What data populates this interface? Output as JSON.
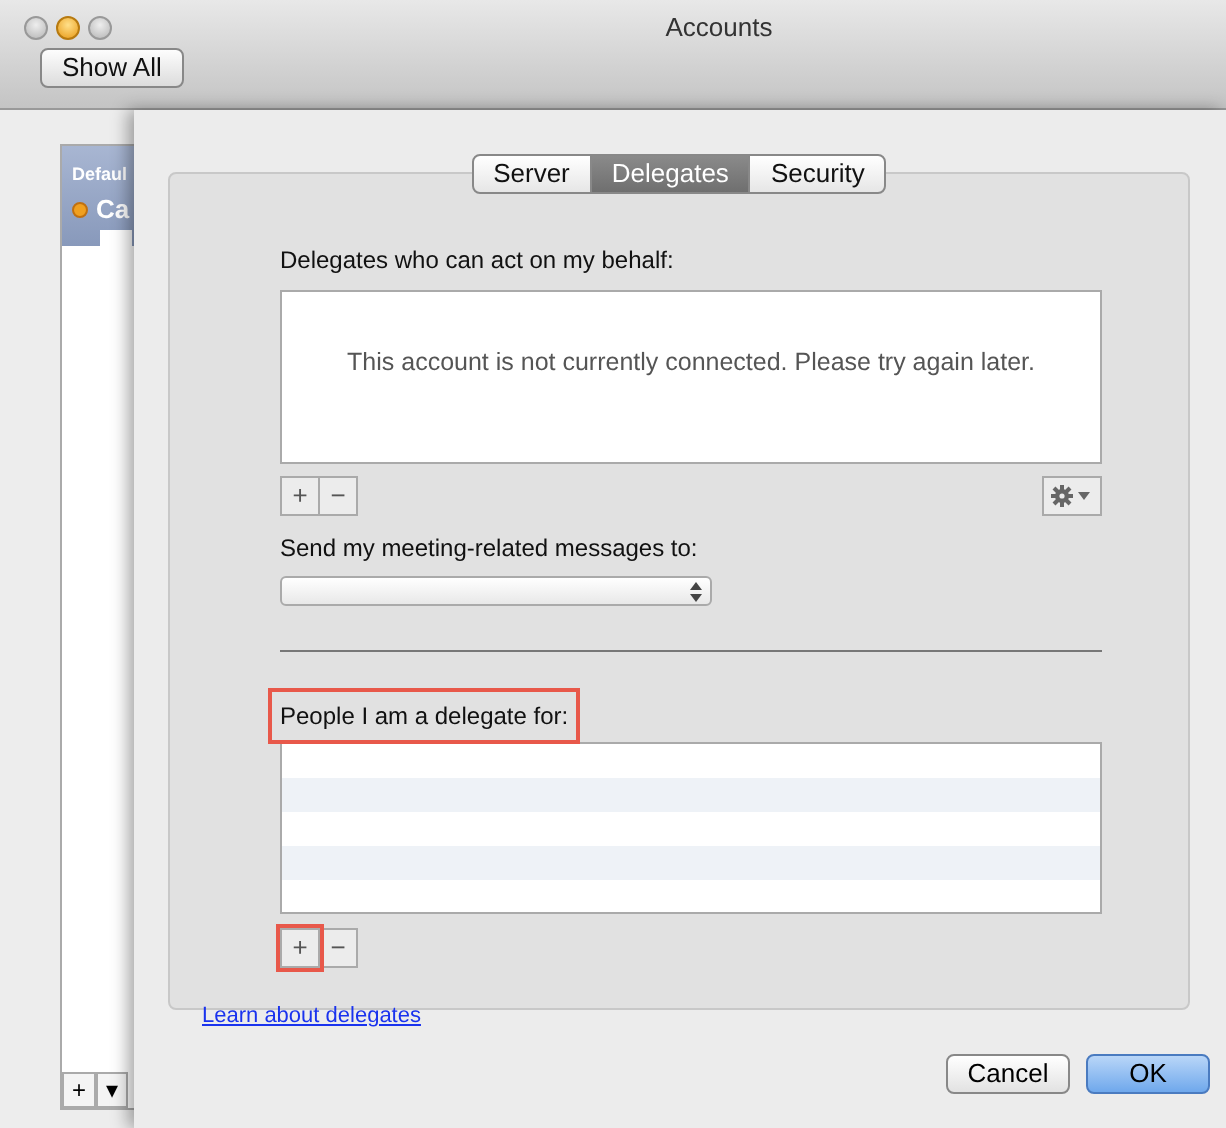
{
  "window": {
    "title": "Accounts",
    "toolbar_button": "Show All"
  },
  "sidebar": {
    "header": "Defaul",
    "account": "Ca",
    "buttons": [
      "+",
      "▾"
    ]
  },
  "sheet": {
    "tabs": [
      {
        "label": "Server",
        "selected": false
      },
      {
        "label": "Delegates",
        "selected": true
      },
      {
        "label": "Security",
        "selected": false
      }
    ],
    "delegates": {
      "label": "Delegates who can act on my behalf:",
      "message": "This account is not currently connected. Please try again later.",
      "buttons": [
        {
          "label": "+",
          "highlighted": false
        },
        {
          "label": "−",
          "highlighted": false
        }
      ]
    },
    "meeting": {
      "label": "Send my meeting-related messages to:"
    },
    "delegate_for": {
      "label": "People I am a delegate for:",
      "highlighted": true,
      "buttons": [
        {
          "label": "+",
          "highlighted": true
        },
        {
          "label": "−",
          "highlighted": false
        }
      ]
    },
    "link": "Learn about delegates",
    "buttons": [
      {
        "label": "Cancel",
        "kind": "secondary"
      },
      {
        "label": "OK",
        "kind": "default"
      }
    ]
  }
}
